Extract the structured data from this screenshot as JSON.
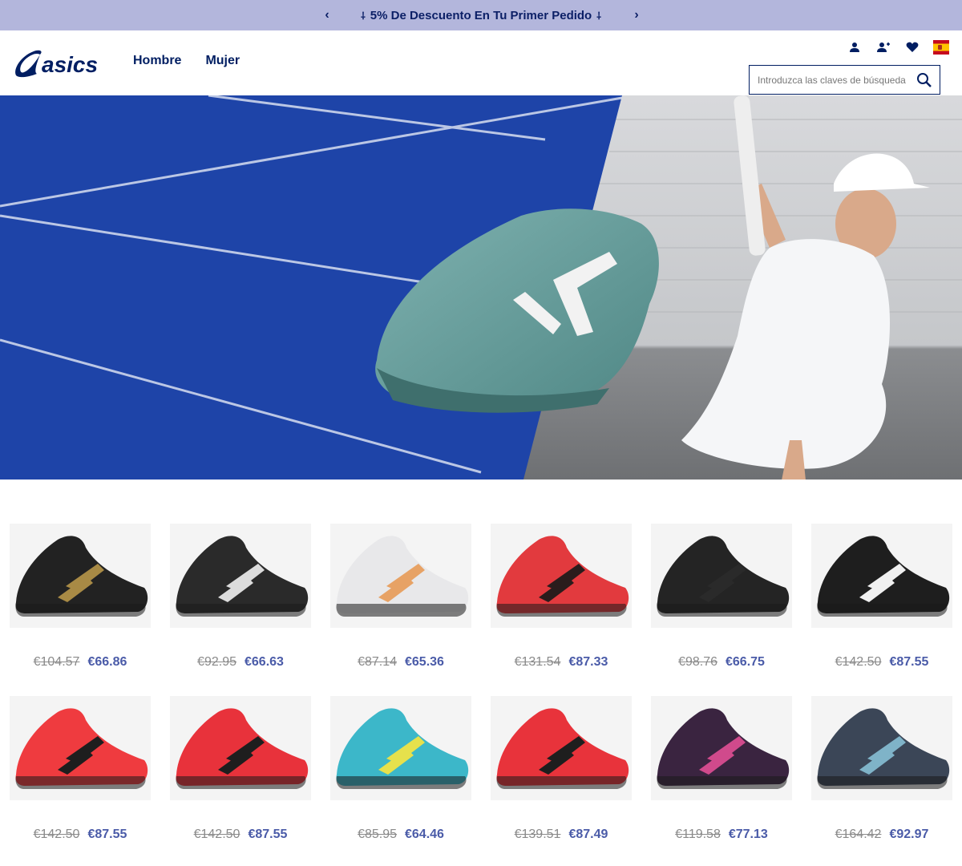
{
  "promo": {
    "prev": "‹",
    "next": "›",
    "spark": "⸸",
    "text": "5% De Descuento En Tu Primer Pedido"
  },
  "header": {
    "logo": "asics",
    "nav": [
      {
        "label": "Hombre"
      },
      {
        "label": "Mujer"
      }
    ],
    "icons": [
      "account-icon",
      "register-icon",
      "wishlist-heart-icon",
      "spain-flag-icon"
    ],
    "search": {
      "placeholder": "Introduzca las claves de búsqueda"
    }
  },
  "products": {
    "row1": [
      {
        "old": "€104.57",
        "new": "€66.86",
        "color": "#222222",
        "accent": "#a88a45"
      },
      {
        "old": "€92.95",
        "new": "€66.63",
        "color": "#2a2a2a",
        "accent": "#dcdcdc"
      },
      {
        "old": "€87.14",
        "new": "€65.36",
        "color": "#e8e8ea",
        "accent": "#e7a265"
      },
      {
        "old": "€131.54",
        "new": "€87.33",
        "color": "#e23a3e",
        "accent": "#2a1c1c"
      },
      {
        "old": "€98.76",
        "new": "€66.75",
        "color": "#242424",
        "accent": "#2a2a2a"
      },
      {
        "old": "€142.50",
        "new": "€87.55",
        "color": "#1e1e1e",
        "accent": "#f0f0f0"
      }
    ],
    "row2": [
      {
        "old": "€142.50",
        "new": "€87.55",
        "color": "#ef3b3f",
        "accent": "#1e1e1e"
      },
      {
        "old": "€142.50",
        "new": "€87.55",
        "color": "#e8323b",
        "accent": "#1e1e1e"
      },
      {
        "old": "€85.95",
        "new": "€64.46",
        "color": "#3cb7c9",
        "accent": "#e6e14c"
      },
      {
        "old": "€139.51",
        "new": "€87.49",
        "color": "#e8333b",
        "accent": "#1e1e1e"
      },
      {
        "old": "€119.58",
        "new": "€77.13",
        "color": "#3a2440",
        "accent": "#d04a8c"
      },
      {
        "old": "€164.42",
        "new": "€92.97",
        "color": "#3b4657",
        "accent": "#7fb3c8"
      }
    ]
  },
  "colors": {
    "brand": "#001e62",
    "promo_bg": "#b3b6dc",
    "price_new": "#4a5ba8",
    "court_blue": "#1e44a8"
  }
}
